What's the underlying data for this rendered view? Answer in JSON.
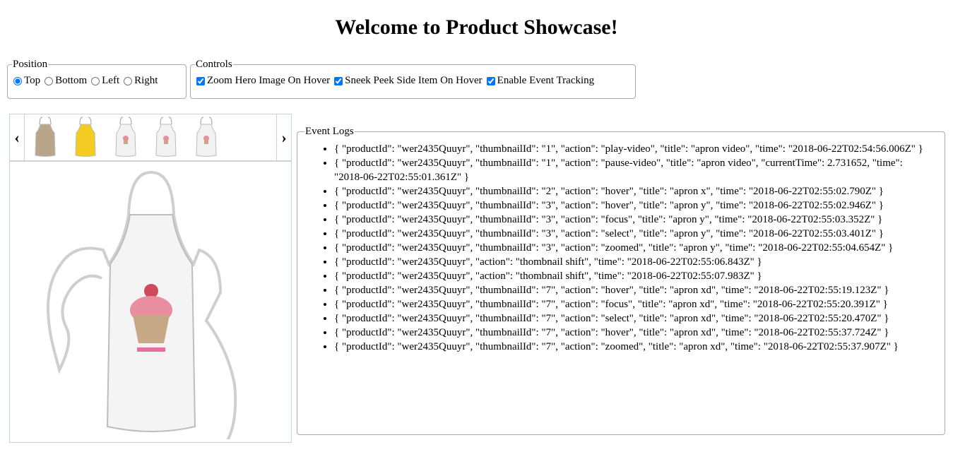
{
  "title": "Welcome to Product Showcase!",
  "position": {
    "legend": "Position",
    "options": [
      {
        "label": "Top",
        "checked": true
      },
      {
        "label": "Bottom",
        "checked": false
      },
      {
        "label": "Left",
        "checked": false
      },
      {
        "label": "Right",
        "checked": false
      }
    ]
  },
  "controls": {
    "legend": "Controls",
    "options": [
      {
        "label": "Zoom Hero Image On Hover",
        "checked": true
      },
      {
        "label": "Sneek Peek Side Item On Hover",
        "checked": true
      },
      {
        "label": "Enable Event Tracking",
        "checked": true
      }
    ]
  },
  "gallery": {
    "prev_icon": "chevron-left-icon",
    "next_icon": "chevron-right-icon",
    "thumbnails": [
      {
        "color": "#b9a58a"
      },
      {
        "color": "#f2cc22"
      },
      {
        "color": "#f2f2f2"
      },
      {
        "color": "#f2f2f2"
      },
      {
        "color": "#f2f2f2"
      }
    ]
  },
  "event_logs": {
    "legend": "Event Logs",
    "items": [
      "{ \"productId\": \"wer2435Quuyr\", \"thumbnailId\": \"1\", \"action\": \"play-video\", \"title\": \"apron video\", \"time\": \"2018-06-22T02:54:56.006Z\" }",
      "{ \"productId\": \"wer2435Quuyr\", \"thumbnailId\": \"1\", \"action\": \"pause-video\", \"title\": \"apron video\", \"currentTime\": 2.731652, \"time\": \"2018-06-22T02:55:01.361Z\" }",
      "{ \"productId\": \"wer2435Quuyr\", \"thumbnailId\": \"2\", \"action\": \"hover\", \"title\": \"apron x\", \"time\": \"2018-06-22T02:55:02.790Z\" }",
      "{ \"productId\": \"wer2435Quuyr\", \"thumbnailId\": \"3\", \"action\": \"hover\", \"title\": \"apron y\", \"time\": \"2018-06-22T02:55:02.946Z\" }",
      "{ \"productId\": \"wer2435Quuyr\", \"thumbnailId\": \"3\", \"action\": \"focus\", \"title\": \"apron y\", \"time\": \"2018-06-22T02:55:03.352Z\" }",
      "{ \"productId\": \"wer2435Quuyr\", \"thumbnailId\": \"3\", \"action\": \"select\", \"title\": \"apron y\", \"time\": \"2018-06-22T02:55:03.401Z\" }",
      "{ \"productId\": \"wer2435Quuyr\", \"thumbnailId\": \"3\", \"action\": \"zoomed\", \"title\": \"apron y\", \"time\": \"2018-06-22T02:55:04.654Z\" }",
      "{ \"productId\": \"wer2435Quuyr\", \"action\": \"thombnail shift\", \"time\": \"2018-06-22T02:55:06.843Z\" }",
      "{ \"productId\": \"wer2435Quuyr\", \"action\": \"thombnail shift\", \"time\": \"2018-06-22T02:55:07.983Z\" }",
      "{ \"productId\": \"wer2435Quuyr\", \"thumbnailId\": \"7\", \"action\": \"hover\", \"title\": \"apron xd\", \"time\": \"2018-06-22T02:55:19.123Z\" }",
      "{ \"productId\": \"wer2435Quuyr\", \"thumbnailId\": \"7\", \"action\": \"focus\", \"title\": \"apron xd\", \"time\": \"2018-06-22T02:55:20.391Z\" }",
      "{ \"productId\": \"wer2435Quuyr\", \"thumbnailId\": \"7\", \"action\": \"select\", \"title\": \"apron xd\", \"time\": \"2018-06-22T02:55:20.470Z\" }",
      "{ \"productId\": \"wer2435Quuyr\", \"thumbnailId\": \"7\", \"action\": \"hover\", \"title\": \"apron xd\", \"time\": \"2018-06-22T02:55:37.724Z\" }",
      "{ \"productId\": \"wer2435Quuyr\", \"thumbnailId\": \"7\", \"action\": \"zoomed\", \"title\": \"apron xd\", \"time\": \"2018-06-22T02:55:37.907Z\" }"
    ]
  }
}
